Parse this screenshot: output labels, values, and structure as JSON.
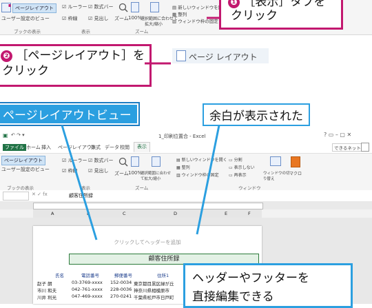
{
  "top_ribbon": {
    "page_layout_btn": "ページレイアウト",
    "page_break_preview": "ページ\nレビュー",
    "user_view": "ユーザー設定のビュー",
    "ruler": "ルーラー",
    "formula_bar": "数式バー",
    "gridlines": "枠線",
    "headings": "見出し",
    "zoom": "ズーム",
    "zoom_100": "100%",
    "zoom_selection": "選択範囲に合わせて\n拡大/縮小",
    "new_window": "新しいウィンドウを開く",
    "arrange": "整列",
    "freeze": "ウィンドウ枠の固定",
    "group_workbook_views": "ブックの表示",
    "group_show": "表示",
    "group_zoom": "ズーム"
  },
  "callouts": {
    "step1_num": "❶",
    "step1_text_line1": "［表示］タブを",
    "step1_text_line2": "クリック",
    "step2_num": "❷",
    "step2_text_line1": "［ページレイアウト］を",
    "step2_text_line2": "クリック",
    "page_layout_icon_label": "ページ レイアウト",
    "label_view": "ページレイアウトビュー",
    "label_margin": "余白が表示された",
    "label_header": "ヘッダーやフッターを",
    "label_header2": "直接編集できる"
  },
  "excel": {
    "title": "1_印刷位置合 - Excel",
    "tabs": [
      "ファイル",
      "ホーム",
      "挿入",
      "ページレイアウト",
      "数式",
      "データ",
      "校閲",
      "表示"
    ],
    "active_tab": "表示",
    "user": "できるネット",
    "formula_value": "顧客住所録",
    "columns": [
      "A",
      "B",
      "C",
      "D",
      "E",
      "F"
    ],
    "ribbon": {
      "page_layout": "ページレイアウト",
      "user_view": "ユーザー設定のビュー",
      "ruler": "ルーラー",
      "formula_bar": "数式バー",
      "gridlines": "枠線",
      "headings": "見出し",
      "zoom": "ズーム",
      "zoom100": "100%",
      "zoom_sel": "選択範囲に合わせて拡大/縮小",
      "new_window": "新しいウィンドウを開く",
      "arrange": "整列",
      "freeze": "ウィンドウ枠の固定",
      "split": "分割",
      "hide": "表示しない",
      "unhide": "再表示",
      "switch": "ウィンドウの切り替え",
      "macro": "マクロ",
      "group_views": "ブックの表示",
      "group_show": "表示",
      "group_zoom": "ズーム",
      "group_window": "ウィンドウ"
    },
    "header_hint": "クリックしてヘッダーを追加",
    "sheet_title": "顧客住所録",
    "table_headers": [
      "氏名",
      "電話番号",
      "郵便番号",
      "住所1"
    ],
    "rows": [
      [
        "赵子 朗",
        "03-3769-xxxx",
        "152-0034",
        "東京都目黒区緑が丘"
      ],
      [
        "市川 和夫",
        "042-761-xxxx",
        "228-0036",
        "神奈川県相模原市"
      ],
      [
        "川井 利光",
        "047-469-xxxx",
        "270-0241",
        "千葉県松戸市日戸町"
      ]
    ]
  }
}
